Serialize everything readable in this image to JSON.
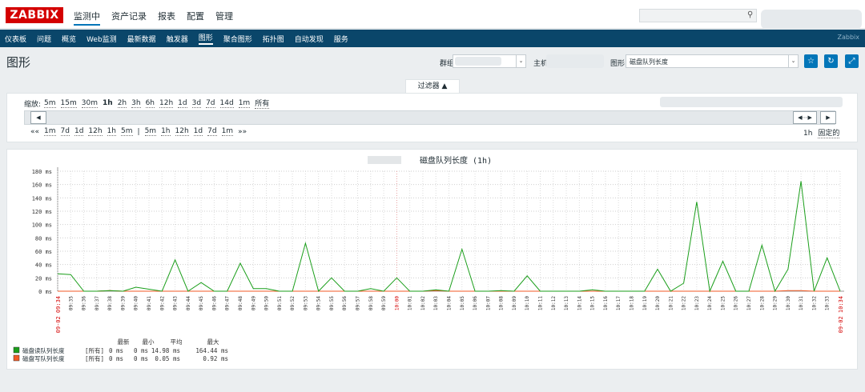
{
  "topbar": {
    "logo": "ZABBIX",
    "menu": [
      "监测中",
      "资产记录",
      "报表",
      "配置",
      "管理"
    ]
  },
  "subnav": {
    "items": [
      "仪表板",
      "问题",
      "概览",
      "Web监测",
      "最新数据",
      "触发器",
      "图形",
      "聚合图形",
      "拓扑图",
      "自动发现",
      "服务"
    ],
    "active": "图形",
    "brand": "Zabbix"
  },
  "page": {
    "title": "图形"
  },
  "controls": {
    "group_label": "群组",
    "host_label": "主机",
    "graph_label": "图形",
    "graph_value": "磁盘队列长度"
  },
  "filter": {
    "tab_label": "过滤器 ▲",
    "zoom_label": "缩放:",
    "zoom_options": [
      "5m",
      "15m",
      "30m",
      "1h",
      "2h",
      "3h",
      "6h",
      "12h",
      "1d",
      "3d",
      "7d",
      "14d",
      "1m",
      "所有"
    ],
    "zoom_active": "1h",
    "period_prefix": "««",
    "period_back": [
      "1m",
      "7d",
      "1d",
      "12h",
      "1h",
      "5m"
    ],
    "period_sep": "|",
    "period_fwd": [
      "5m",
      "1h",
      "12h",
      "1d",
      "7d",
      "1m"
    ],
    "period_suffix": "»»",
    "period_value": "1h",
    "fixed_label": "固定的"
  },
  "chart_data": {
    "type": "line",
    "title": "磁盘队列长度 (1h)",
    "y_unit": "ms",
    "ylim": [
      0,
      180
    ],
    "y_ticks": [
      "180 ms",
      "160 ms",
      "140 ms",
      "120 ms",
      "100 ms",
      "80 ms",
      "60 ms",
      "40 ms",
      "20 ms",
      "0 ms"
    ],
    "x": [
      "09:34",
      "09:35",
      "09:36",
      "09:37",
      "09:38",
      "09:39",
      "09:40",
      "09:41",
      "09:42",
      "09:43",
      "09:44",
      "09:45",
      "09:46",
      "09:47",
      "09:48",
      "09:49",
      "09:50",
      "09:51",
      "09:52",
      "09:53",
      "09:54",
      "09:55",
      "09:56",
      "09:57",
      "09:58",
      "09:59",
      "10:00",
      "10:01",
      "10:02",
      "10:03",
      "10:04",
      "10:05",
      "10:06",
      "10:07",
      "10:08",
      "10:09",
      "10:10",
      "10:11",
      "10:12",
      "10:13",
      "10:14",
      "10:15",
      "10:16",
      "10:17",
      "10:18",
      "10:19",
      "10:20",
      "10:21",
      "10:22",
      "10:23",
      "10:24",
      "10:25",
      "10:26",
      "10:27",
      "10:28",
      "10:29",
      "10:30",
      "10:31",
      "10:32",
      "10:33",
      "10:34"
    ],
    "x_start_label": "09-02 09:34",
    "x_end_label": "09-02 10:34",
    "highlight_tick": "10:00",
    "grid": true,
    "series": [
      {
        "name": "磁盘读队列长度",
        "color": "#1a9e1a",
        "values": [
          26,
          25,
          0,
          0,
          1,
          0,
          6,
          3,
          0,
          47,
          0,
          13,
          0,
          0,
          42,
          4,
          4,
          0,
          0,
          72,
          0,
          20,
          0,
          0,
          4,
          0,
          20,
          0,
          0,
          2,
          0,
          63,
          0,
          0,
          1,
          0,
          23,
          0,
          0,
          0,
          0,
          2,
          0,
          0,
          0,
          0,
          33,
          0,
          12,
          134,
          0,
          45,
          0,
          0,
          69,
          0,
          33,
          165,
          0,
          50,
          0
        ]
      },
      {
        "name": "磁盘写队列长度",
        "color": "#f15a24",
        "values": [
          0,
          0,
          0,
          0,
          1,
          0,
          0,
          0,
          0,
          0,
          0,
          0,
          0,
          0,
          0,
          0,
          0,
          0,
          0,
          0,
          0,
          0,
          0,
          0,
          0,
          0,
          0,
          0,
          0,
          1,
          0,
          0,
          0,
          0,
          0,
          0,
          0,
          0,
          0,
          0,
          0,
          0,
          0,
          0,
          0,
          0,
          0,
          0,
          0,
          0,
          0,
          0,
          0,
          0,
          0,
          0,
          1,
          1,
          0,
          0,
          0
        ]
      }
    ],
    "legend": {
      "headers": [
        "最新",
        "最小",
        "平均",
        "最大"
      ],
      "rows": [
        {
          "name": "磁盘读队列长度",
          "scope": "[所有]",
          "last": "0 ms",
          "min": "0 ms",
          "avg": "14.98 ms",
          "max": "164.44 ms",
          "color": "#1a9e1a"
        },
        {
          "name": "磁盘写队列长度",
          "scope": "[所有]",
          "last": "0 ms",
          "min": "0 ms",
          "avg": "0.05 ms",
          "max": "0.92 ms",
          "color": "#f15a24"
        }
      ]
    }
  }
}
